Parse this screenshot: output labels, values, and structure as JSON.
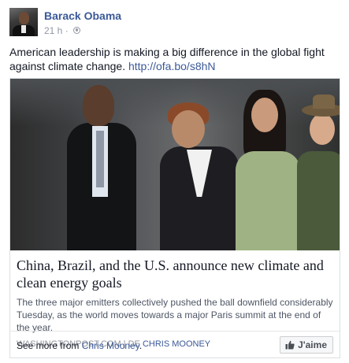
{
  "post": {
    "author": "Barack Obama",
    "time": "21 h",
    "separator": "·",
    "privacy_icon": "globe-icon",
    "text": "American leadership is making a big difference in the global fight against climate change. ",
    "link": "http://ofa.bo/s8hN"
  },
  "card": {
    "title": "China, Brazil, and the U.S. announce new climate and clean energy goals",
    "description": "The three major emitters collectively pushed the ball downfield considerably Tuesday, as the world moves towards a major Paris summit at the end of the year.",
    "source": "WASHINGTONPOST.COM | DE ",
    "author": "CHRIS MOONEY",
    "footer": {
      "see_more_prefix": "See more from ",
      "see_more_name": "Chris Mooney",
      "see_more_suffix": ".",
      "like_label": "J'aime",
      "like_icon": "thumbs-up-icon"
    }
  },
  "colors": {
    "link": "#3b5998",
    "text": "#141823",
    "muted": "#9197a3"
  }
}
